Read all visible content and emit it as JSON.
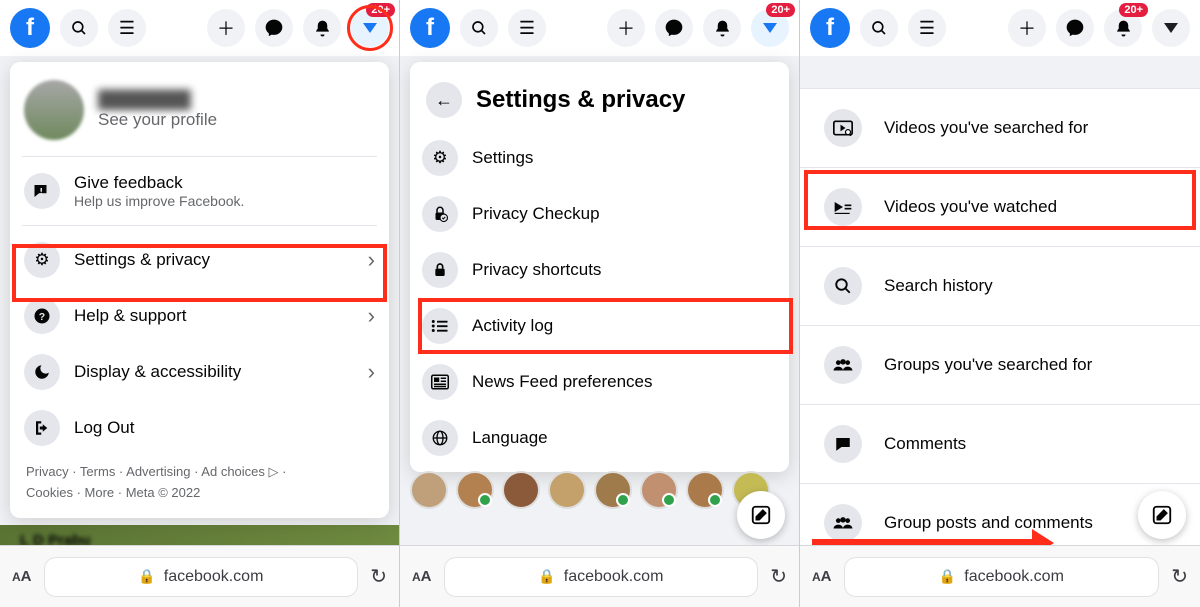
{
  "badge": "20+",
  "url": "facebook.com",
  "col1": {
    "profile_name": "████████",
    "profile_sub": "See your profile",
    "feedback": {
      "label": "Give feedback",
      "sub": "Help us improve Facebook."
    },
    "items": [
      {
        "label": "Settings & privacy"
      },
      {
        "label": "Help & support"
      },
      {
        "label": "Display & accessibility"
      },
      {
        "label": "Log Out"
      }
    ],
    "footer1": "Privacy · Terms · Advertising · Ad choices ▷ ·",
    "footer2": "Cookies · More · Meta © 2022"
  },
  "col2": {
    "title": "Settings & privacy",
    "items": [
      {
        "label": "Settings"
      },
      {
        "label": "Privacy Checkup"
      },
      {
        "label": "Privacy shortcuts"
      },
      {
        "label": "Activity log"
      },
      {
        "label": "News Feed preferences"
      },
      {
        "label": "Language"
      }
    ]
  },
  "col3": {
    "items": [
      {
        "label": "Videos you've searched for"
      },
      {
        "label": "Videos you've watched"
      },
      {
        "label": "Search history"
      },
      {
        "label": "Groups you've searched for"
      },
      {
        "label": "Comments"
      },
      {
        "label": "Group posts and comments"
      }
    ]
  }
}
